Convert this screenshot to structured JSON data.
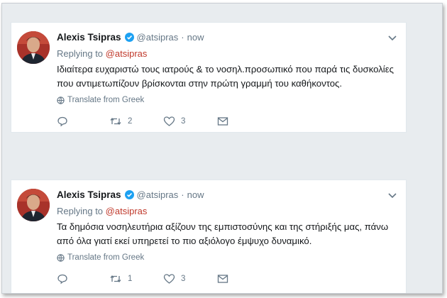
{
  "tweets": [
    {
      "name": "Alexis Tsipras",
      "handle": "@atsipras",
      "separator": "·",
      "time": "now",
      "replying_prefix": "Replying to",
      "replying_to": "@atsipras",
      "text": "Ιδιαίτερα ευχαριστώ τους ιατρούς & το νοσηλ.προσωπικό που παρά τις δυσκολίες που αντιμετωπίζουν βρίσκονται στην πρώτη γραμμή του καθήκοντος.",
      "translate": "Translate from Greek",
      "retweets": "2",
      "likes": "3"
    },
    {
      "name": "Alexis Tsipras",
      "handle": "@atsipras",
      "separator": "·",
      "time": "now",
      "replying_prefix": "Replying to",
      "replying_to": "@atsipras",
      "text": "Τα δημόσια νοσηλευτήρια αξίζουν της εμπιστοσύνης και της στήριξής μας, πάνω από όλα γιατί εκεί υπηρετεί το πιο αξιόλογο έμψυχο δυναμικό.",
      "translate": "Translate from Greek",
      "retweets": "1",
      "likes": "3"
    }
  ],
  "colors": {
    "verified": "#1da1f2",
    "mention": "#c0392b",
    "muted": "#657786",
    "text": "#14171a"
  },
  "icons": [
    "verified-badge-icon",
    "chevron-down-icon",
    "globe-icon",
    "reply-icon",
    "retweet-icon",
    "heart-icon",
    "direct-message-icon"
  ]
}
